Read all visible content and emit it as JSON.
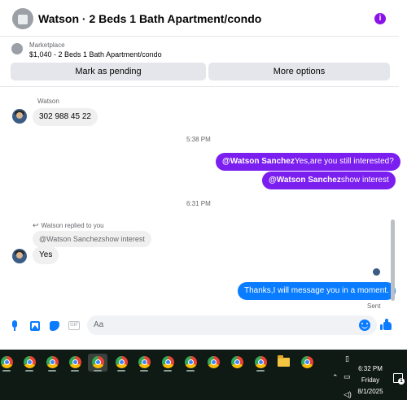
{
  "header": {
    "title": "Watson · 2 Beds 1 Bath Apartment/condo",
    "info_icon": "info-icon"
  },
  "marketplace": {
    "label": "Marketplace",
    "listing": "$1,040 - 2 Beds 1 Bath Apartment/condo"
  },
  "actions": {
    "pending_label": "Mark as pending",
    "more_label": "More options"
  },
  "messages": {
    "sender_name": "Watson",
    "msg1": "302 988 45 22",
    "time1": "5:38 PM",
    "msg2_mention": "@Watson Sanchez",
    "msg2_text": "Yes,are you still interested?",
    "msg3_mention": "@Watson Sanchez",
    "msg3_text": "show interest",
    "time2": "6:31 PM",
    "reply_note": "Watson replied to you",
    "quoted": "@Watson Sanchezshow interest",
    "msg4": "Yes",
    "msg5": "Thanks,I will message you in a moment.",
    "status": "Sent"
  },
  "composer": {
    "placeholder": "Aa"
  },
  "taskbar": {
    "time": "6:32 PM",
    "day": "Friday",
    "date": "8/1/2025",
    "notif_count": "1"
  },
  "colors": {
    "accent_purple": "#7b1ef0",
    "accent_blue": "#0a7cff",
    "taskbar_bg": "#101a14"
  }
}
